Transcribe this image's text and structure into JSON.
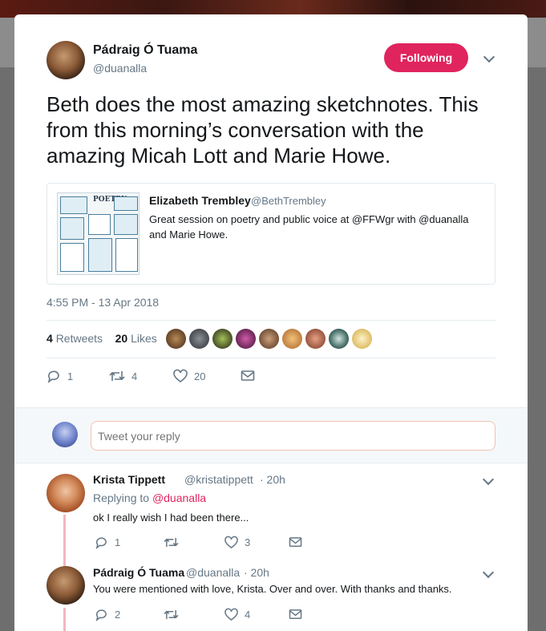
{
  "tweet": {
    "author_name": "Pádraig Ó Tuama",
    "author_handle": "@duanalla",
    "follow_label": "Following",
    "text": "Beth does the most amazing sketchnotes. This from this morning’s conversation with the amazing Micah Lott and Marie Howe.",
    "quote": {
      "author_name": "Elizabeth Trembley",
      "author_handle": "@BethTrembley",
      "text": "Great session on poetry and public voice at @FFWgr with @duanalla and Marie Howe.",
      "thumb_title": "POETRY"
    },
    "timestamp": "4:55 PM - 13 Apr 2018",
    "retweets_count": "4",
    "retweets_label": "Retweets",
    "likes_count": "20",
    "likes_label": "Likes",
    "actions": {
      "replies": "1",
      "retweets": "4",
      "likes": "20"
    }
  },
  "reply_box": {
    "placeholder": "Tweet your reply"
  },
  "replies": [
    {
      "name": "Krista Tippett",
      "handle": "@kristatippett",
      "time": "· 20h",
      "replying_prefix": "Replying to",
      "replying_to": "@duanalla",
      "text": "ok I really wish I had been there...",
      "replies": "1",
      "retweets": "",
      "likes": "3"
    },
    {
      "name": "Pádraig Ó Tuama",
      "handle": "@duanalla",
      "time": "· 20h",
      "text": "You were mentioned with love, Krista. Over and over. With thanks and thanks.",
      "replies": "2",
      "retweets": "",
      "likes": "4"
    }
  ],
  "colors": {
    "accent": "#e0245e",
    "muted": "#657786",
    "text": "#14171a",
    "thread": "#f4b6c1"
  }
}
